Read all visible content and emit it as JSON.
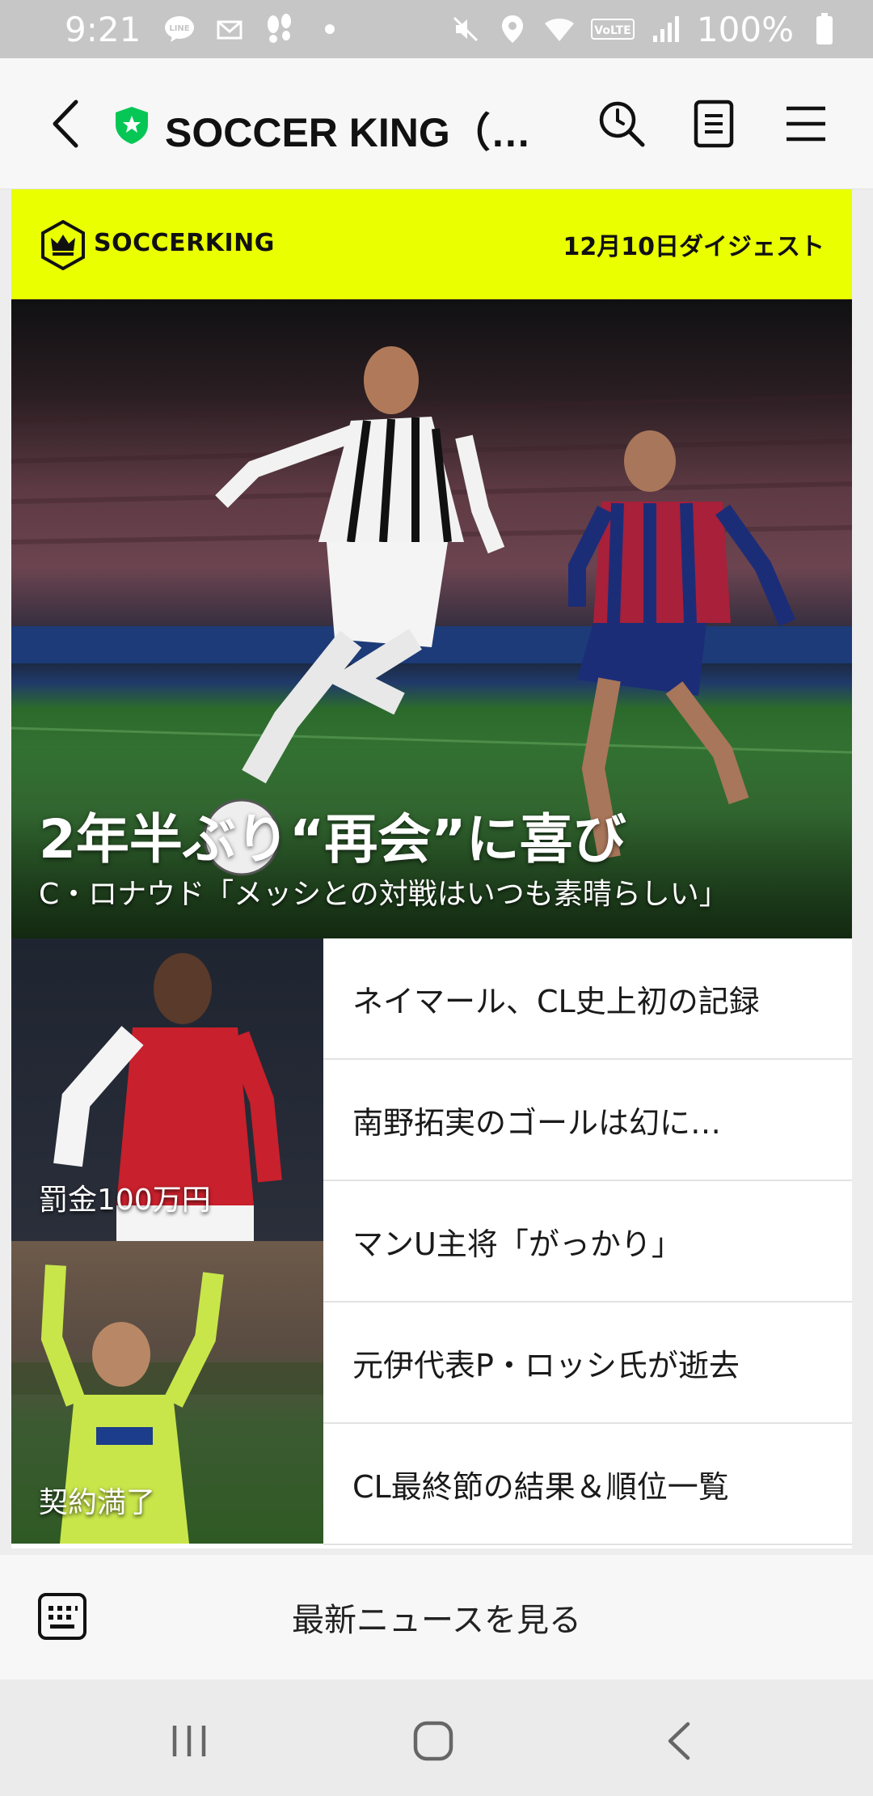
{
  "status_bar": {
    "time": "9:21",
    "battery": "100%",
    "lte_label": "VoLTE",
    "left_icons": [
      "line-icon",
      "mail-icon",
      "footprints-icon",
      "dot-icon"
    ],
    "right_icons": [
      "mute-icon",
      "location-icon",
      "wifi-icon",
      "volte-icon",
      "signal-icon",
      "battery-icon"
    ]
  },
  "header": {
    "title": "SOCCER KING（サッカーキング）",
    "icons": [
      "back-icon",
      "shield-star-icon",
      "search-icon",
      "document-icon",
      "menu-icon"
    ],
    "accent": "#06c755"
  },
  "card": {
    "banner_color": "#eaff00",
    "brand": "SOCCERKING",
    "digest": "12月10日ダイジェスト",
    "hero": {
      "title": "2年半ぶり“再会”に喜び",
      "subtitle": "C・ロナウド「メッシとの対戦はいつも素晴らしい」"
    },
    "thumbnails": [
      {
        "caption": "罰金100万円"
      },
      {
        "caption": "契約満了"
      }
    ],
    "news": [
      "ネイマール、CL史上初の記録",
      "南野拓実のゴールは幻に…",
      "マンU主将「がっかり」",
      "元伊代表P・ロッシ氏が逝去",
      "CL最終節の結果＆順位一覧"
    ]
  },
  "bottom": {
    "latest_label": "最新ニュースを見る",
    "icon": "keyboard-icon"
  },
  "nav": {
    "icons": [
      "recents-icon",
      "home-icon",
      "back-nav-icon"
    ]
  }
}
